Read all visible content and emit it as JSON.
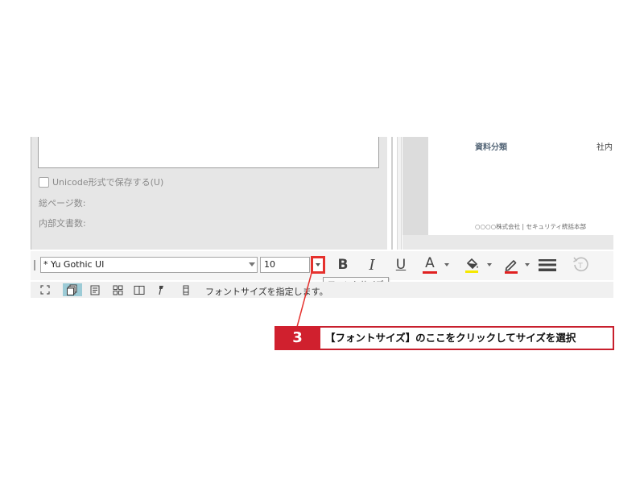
{
  "dialog": {
    "unicode_option_label": "Unicode形式で保存する(U)",
    "unicode_option_checked": false,
    "total_pages_label": "総ページ数:",
    "internal_docs_label": "内部文書数:"
  },
  "preview": {
    "doc_category": "資料分類",
    "internal_label": "社内",
    "footer_text": "○○○○株式会社 | セキュリティ統括本部"
  },
  "toolbar": {
    "font_name": "* Yu Gothic UI",
    "font_size": "10",
    "bold_label": "B",
    "italic_label": "I",
    "underline_label": "U",
    "font_color_label": "A",
    "font_color": "#e02020",
    "highlight_color": "#f5e800",
    "pen_color": "#e02020"
  },
  "tooltip": {
    "text": "フォントサイズ"
  },
  "statusbar": {
    "message": "フォントサイズを指定します。"
  },
  "callout": {
    "step": "3",
    "text": "【フォントサイズ】のここをクリックしてサイズを選択"
  }
}
